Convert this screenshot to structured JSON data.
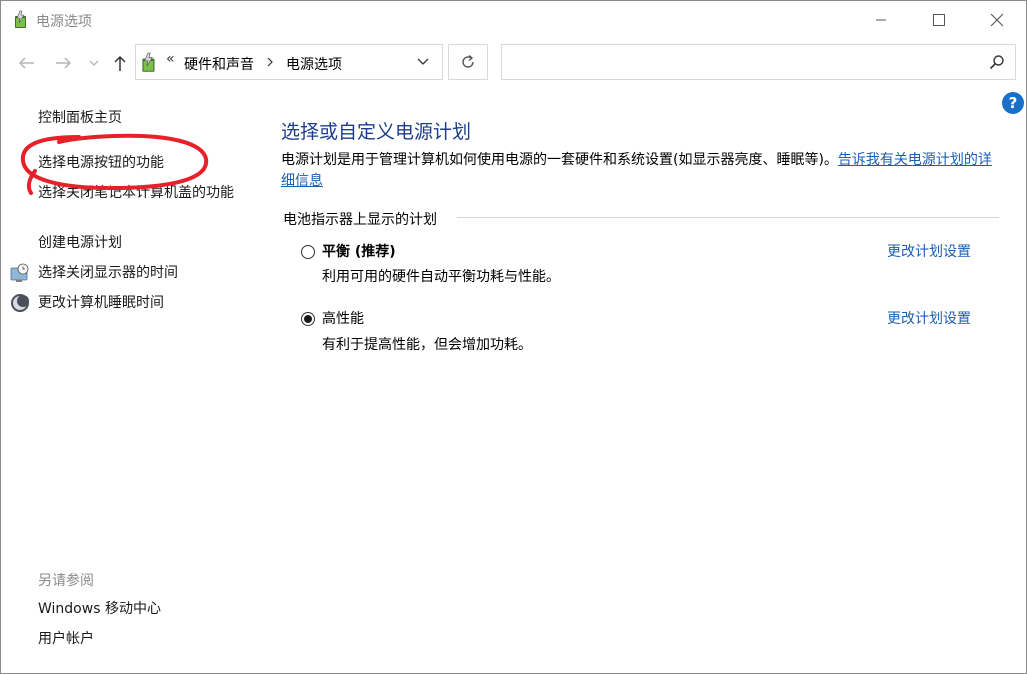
{
  "window": {
    "title": "电源选项"
  },
  "address_bar": {
    "overflow": "«",
    "crumbs": [
      "硬件和声音",
      "电源选项"
    ],
    "search_placeholder": ""
  },
  "left_pane": {
    "home": "控制面板主页",
    "links": [
      "选择电源按钮的功能",
      "选择关闭笔记本计算机盖的功能",
      "创建电源计划",
      "选择关闭显示器的时间",
      "更改计算机睡眠时间"
    ],
    "see_also_label": "另请参阅",
    "see_also": [
      "Windows 移动中心",
      "用户帐户"
    ]
  },
  "main": {
    "title": "选择或自定义电源计划",
    "description": "电源计划是用于管理计算机如何使用电源的一套硬件和系统设置(如显示器亮度、睡眠等)。",
    "description_link": "告诉我有关电源计划的详细信息",
    "group_label": "电池指示器上显示的计划",
    "plans": [
      {
        "name": "平衡 (推荐)",
        "desc": "利用可用的硬件自动平衡功耗与性能。",
        "link": "更改计划设置",
        "selected": false
      },
      {
        "name": "高性能",
        "desc": "有利于提高性能，但会增加功耗。",
        "link": "更改计划设置",
        "selected": true
      }
    ]
  },
  "help_label": "?",
  "colors": {
    "title_blue": "#1e3d8f",
    "link_blue": "#1a5fb4",
    "annotation_red": "#e8202a"
  },
  "icons": [
    "power-options-icon",
    "back-arrow-icon",
    "forward-arrow-icon",
    "recent-dropdown-icon",
    "up-arrow-icon",
    "refresh-icon",
    "search-icon",
    "help-icon",
    "minimize-icon",
    "maximize-icon",
    "close-icon",
    "display-clock-icon",
    "sleep-moon-icon"
  ]
}
